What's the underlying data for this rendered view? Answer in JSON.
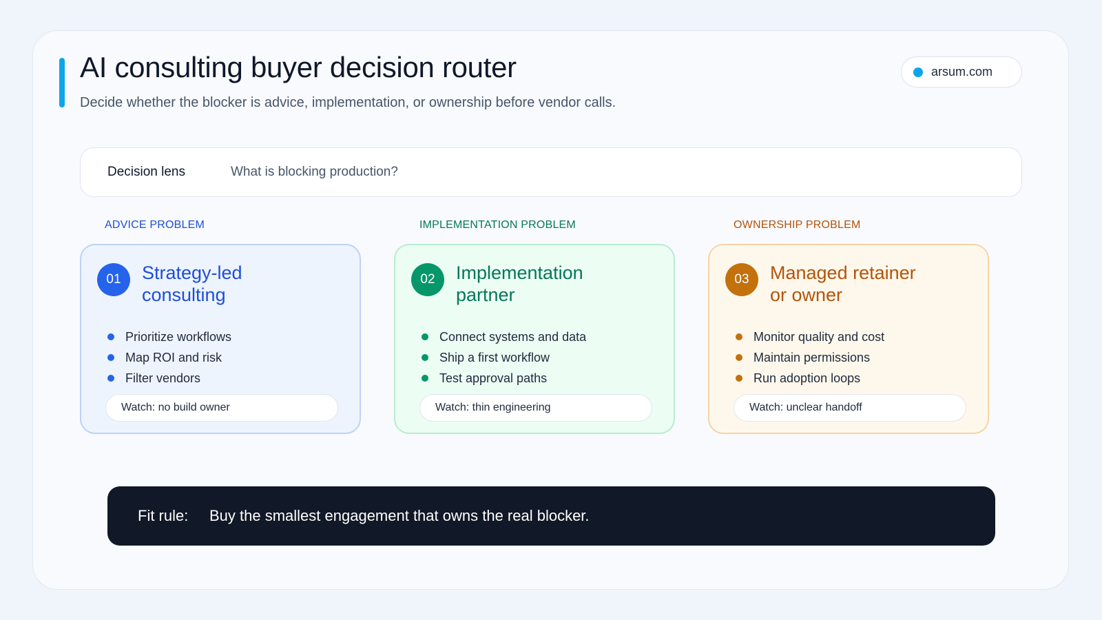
{
  "header": {
    "title": "AI consulting buyer decision router",
    "subtitle": "Decide whether the blocker is advice, implementation, or ownership before vendor calls.",
    "domain": "arsum.com"
  },
  "lens": {
    "label": "Decision lens",
    "question": "What is blocking production?"
  },
  "columns": [
    {
      "category": "ADVICE PROBLEM",
      "number": "01",
      "title_line1": "Strategy-led",
      "title_line2": "consulting",
      "bullets": [
        "Prioritize workflows",
        "Map ROI and risk",
        "Filter vendors"
      ],
      "watch": "Watch: no build owner",
      "accent": "#2563eb",
      "text_color": "#1d4ed8",
      "bg": "#eef4fe",
      "border": "#bcd3f5"
    },
    {
      "category": "IMPLEMENTATION PROBLEM",
      "number": "02",
      "title_line1": "Implementation",
      "title_line2": "partner",
      "bullets": [
        "Connect systems and data",
        "Ship a first workflow",
        "Test approval paths"
      ],
      "watch": "Watch: thin engineering",
      "accent": "#059669",
      "text_color": "#047857",
      "bg": "#ecfdf4",
      "border": "#b8ecd0"
    },
    {
      "category": "OWNERSHIP PROBLEM",
      "number": "03",
      "title_line1": "Managed retainer",
      "title_line2": "or owner",
      "bullets": [
        "Monitor quality and cost",
        "Maintain permissions",
        "Run adoption loops"
      ],
      "watch": "Watch: unclear handoff",
      "accent": "#c2710c",
      "text_color": "#b45309",
      "bg": "#fef8ec",
      "border": "#f7d4a4"
    }
  ],
  "fit_rule": {
    "label": "Fit rule:",
    "text": "Buy the smallest engagement that owns the real blocker."
  }
}
